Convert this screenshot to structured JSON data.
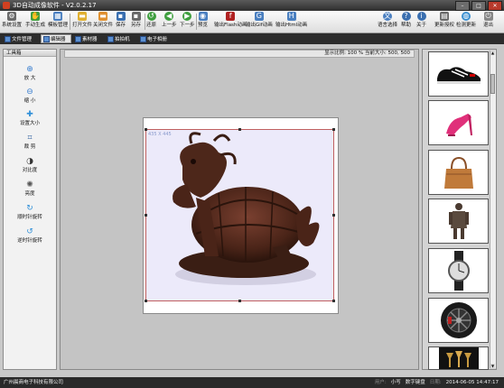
{
  "window": {
    "title": "3D自动成像软件 - V2.0.2.17"
  },
  "toolbar": {
    "items": [
      {
        "label": "系统设置",
        "icon": "gear-icon",
        "color": "#6a6a6a"
      },
      {
        "label": "手动生成",
        "icon": "hand-icon",
        "color": "#3f9f3f"
      },
      {
        "label": "模板管理",
        "icon": "grid-icon",
        "color": "#4a7fc0"
      },
      {
        "label": "打开文件",
        "icon": "folder-open-icon",
        "color": "#e0b030"
      },
      {
        "label": "关闭文件",
        "icon": "folder-close-icon",
        "color": "#e09030"
      },
      {
        "label": "保存",
        "icon": "save-icon",
        "color": "#3a6fb0"
      },
      {
        "label": "另存",
        "icon": "save-as-icon",
        "color": "#6a6a6a"
      },
      {
        "label": "还原",
        "icon": "undo-icon",
        "color": "#3f9f3f"
      },
      {
        "label": "上一步",
        "icon": "arrow-left-icon",
        "color": "#3f9f3f"
      },
      {
        "label": "下一步",
        "icon": "arrow-right-icon",
        "color": "#3f9f3f"
      },
      {
        "label": "预览",
        "icon": "preview-icon",
        "color": "#4a7fc0"
      },
      {
        "label": "输出Flash动画",
        "icon": "flash-icon",
        "color": "#b02020"
      },
      {
        "label": "输出Gif动画",
        "icon": "gif-icon",
        "color": "#4a7fc0"
      },
      {
        "label": "输出Html动画",
        "icon": "html-icon",
        "color": "#4a7fc0"
      },
      {
        "label": "语言选择",
        "icon": "language-icon",
        "color": "#4a7fc0"
      },
      {
        "label": "帮助",
        "icon": "help-icon",
        "color": "#3a6fb0"
      },
      {
        "label": "关于",
        "icon": "about-icon",
        "color": "#3a6fb0"
      },
      {
        "label": "更新授权",
        "icon": "license-icon",
        "color": "#6a6a6a"
      },
      {
        "label": "检测更新",
        "icon": "update-icon",
        "color": "#3a8fd0"
      },
      {
        "label": "退出",
        "icon": "exit-icon",
        "color": "#888888"
      }
    ]
  },
  "tabs": [
    {
      "label": "文件管理",
      "active": false
    },
    {
      "label": "编辑器",
      "active": true
    },
    {
      "label": "素材器",
      "active": false
    },
    {
      "label": "拍拍机",
      "active": false
    },
    {
      "label": "电子相册",
      "active": false
    }
  ],
  "toolbox": {
    "title": "工具箱",
    "tools": [
      {
        "label": "放 大",
        "icon": "zoom-in-icon"
      },
      {
        "label": "缩 小",
        "icon": "zoom-out-icon"
      },
      {
        "label": "设置大小",
        "icon": "resize-icon"
      },
      {
        "label": "裁 剪",
        "icon": "crop-icon"
      },
      {
        "label": "对比度",
        "icon": "contrast-icon"
      },
      {
        "label": "亮度",
        "icon": "brightness-icon"
      },
      {
        "label": "顺时针旋转",
        "icon": "rotate-cw-icon"
      },
      {
        "label": "逆时针旋转",
        "icon": "rotate-ccw-icon"
      }
    ]
  },
  "editor": {
    "info": "显示比例: 100 %   当前大小: 500, 500",
    "size_label": "435 X 445"
  },
  "thumbnails": [
    {
      "name": "sneaker"
    },
    {
      "name": "high-heel"
    },
    {
      "name": "handbag"
    },
    {
      "name": "terracotta-warrior"
    },
    {
      "name": "wristwatch"
    },
    {
      "name": "car-wheel"
    },
    {
      "name": "candle-holders"
    }
  ],
  "status": {
    "company": "广州晨商电子科技有限公司",
    "user_label": "用户:",
    "user": "小写",
    "input": "数字键盘",
    "date_label": "日期:",
    "datetime": "2014-06-05 14:47:17"
  }
}
